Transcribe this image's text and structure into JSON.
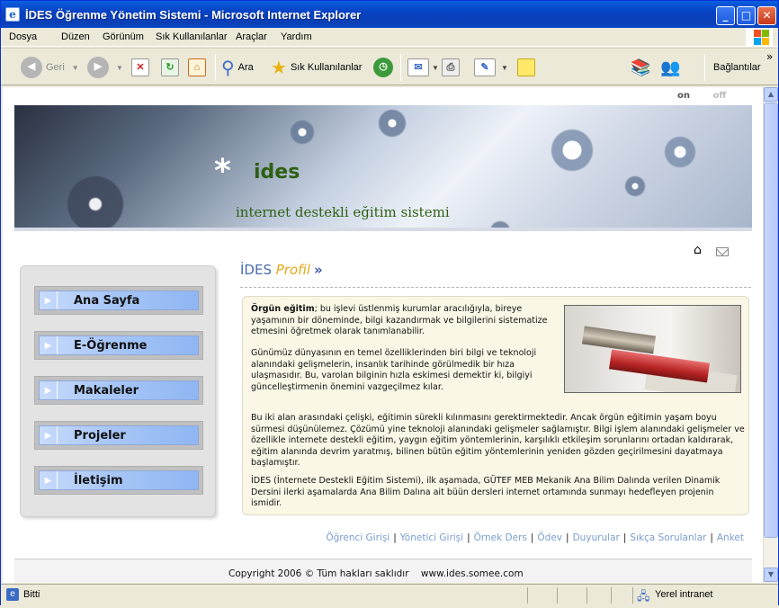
{
  "window": {
    "title": "İDES Öğrenme Yönetim Sistemi - Microsoft Internet Explorer",
    "minimize": "_",
    "maximize": "□",
    "close": "✕"
  },
  "menu": [
    "Dosya",
    "Düzen",
    "Görünüm",
    "Sık Kullanılanlar",
    "Araçlar",
    "Yardım"
  ],
  "toolbar": {
    "back": "Geri",
    "search": "Ara",
    "favorites": "Sık Kullanılanlar",
    "links": "Bağlantılar",
    "more": "»"
  },
  "page": {
    "on": "on",
    "off": "off",
    "banner": {
      "star": "*",
      "brand": "ides",
      "tagline": "internet destekli eğitim sistemi"
    },
    "nav": [
      {
        "label": "Ana Sayfa"
      },
      {
        "label": "E-Öğrenme"
      },
      {
        "label": "Makaleler"
      },
      {
        "label": "Projeler"
      },
      {
        "label": "İletişim"
      }
    ],
    "heading": {
      "part1": "İDES ",
      "part2": "Profil"
    },
    "content": {
      "p1_bold": "Örgün eğitim",
      "p1_rest": "; bu işlevi üstlenmiş kurumlar aracılığıyla, bireye yaşamının bir döneminde, bilgi kazandırmak ve bilgilerini sistematize etmesini öğretmek olarak tanımlanabilir.",
      "p2": "Günümüz dünyasının en temel özelliklerinden biri bilgi ve teknoloji alanındaki gelişmelerin, insanlık tarihinde görülmedik bir hıza ulaşmasıdır. Bu, varolan bilginin hızla eskimesi demektir ki, bilgiyi güncelleştirmenin önemini vazgeçilmez kılar.",
      "p3": "Bu iki alan arasındaki çelişki, eğitimin sürekli kılınmasını gerektirmektedir. Ancak örgün eğitimin yaşam boyu sürmesi düşünülemez. Çözümü yine teknoloji alanındaki gelişmeler sağlamıştır. Bilgi işlem alanındaki gelişmeler ve özellikle internete destekli eğitim, yaygın eğitim yöntemlerinin, karşılıklı etkileşim sorunlarını ortadan kaldırarak, eğitim alanında devrim yaratmış, bilinen bütün eğitim yöntemlerinin yeniden gözden geçirilmesini dayatmaya başlamıştır.",
      "p4": "İDES (İnternete Destekli Eğitim Sistemi), ilk aşamada, GÜTEF MEB Mekanik Ana Bilim Dalında verilen Dinamik Dersini ilerki aşamalarda Ana Bilim Dalına ait büün dersleri internet ortamında sunmayı hedefleyen projenin ismidir."
    },
    "footer_links": [
      "Öğrenci Girişi",
      "Yönetici Girişi",
      "Örnek Ders",
      "Ödev",
      "Duyurular",
      "Sıkça Sorulanlar",
      "Anket"
    ],
    "copyright": "Copyright 2006 © Tüm hakları saklıdır    www.ides.somee.com"
  },
  "status": {
    "left": "Bitti",
    "zone": "Yerel intranet"
  },
  "icons": [
    "ie-icon",
    "back-icon",
    "forward-icon",
    "stop-icon",
    "refresh-icon",
    "home-icon",
    "search-icon",
    "favorites-icon",
    "history-icon",
    "mail-icon",
    "print-icon",
    "edit-icon",
    "note-icon",
    "research-icon",
    "messenger-icon"
  ]
}
